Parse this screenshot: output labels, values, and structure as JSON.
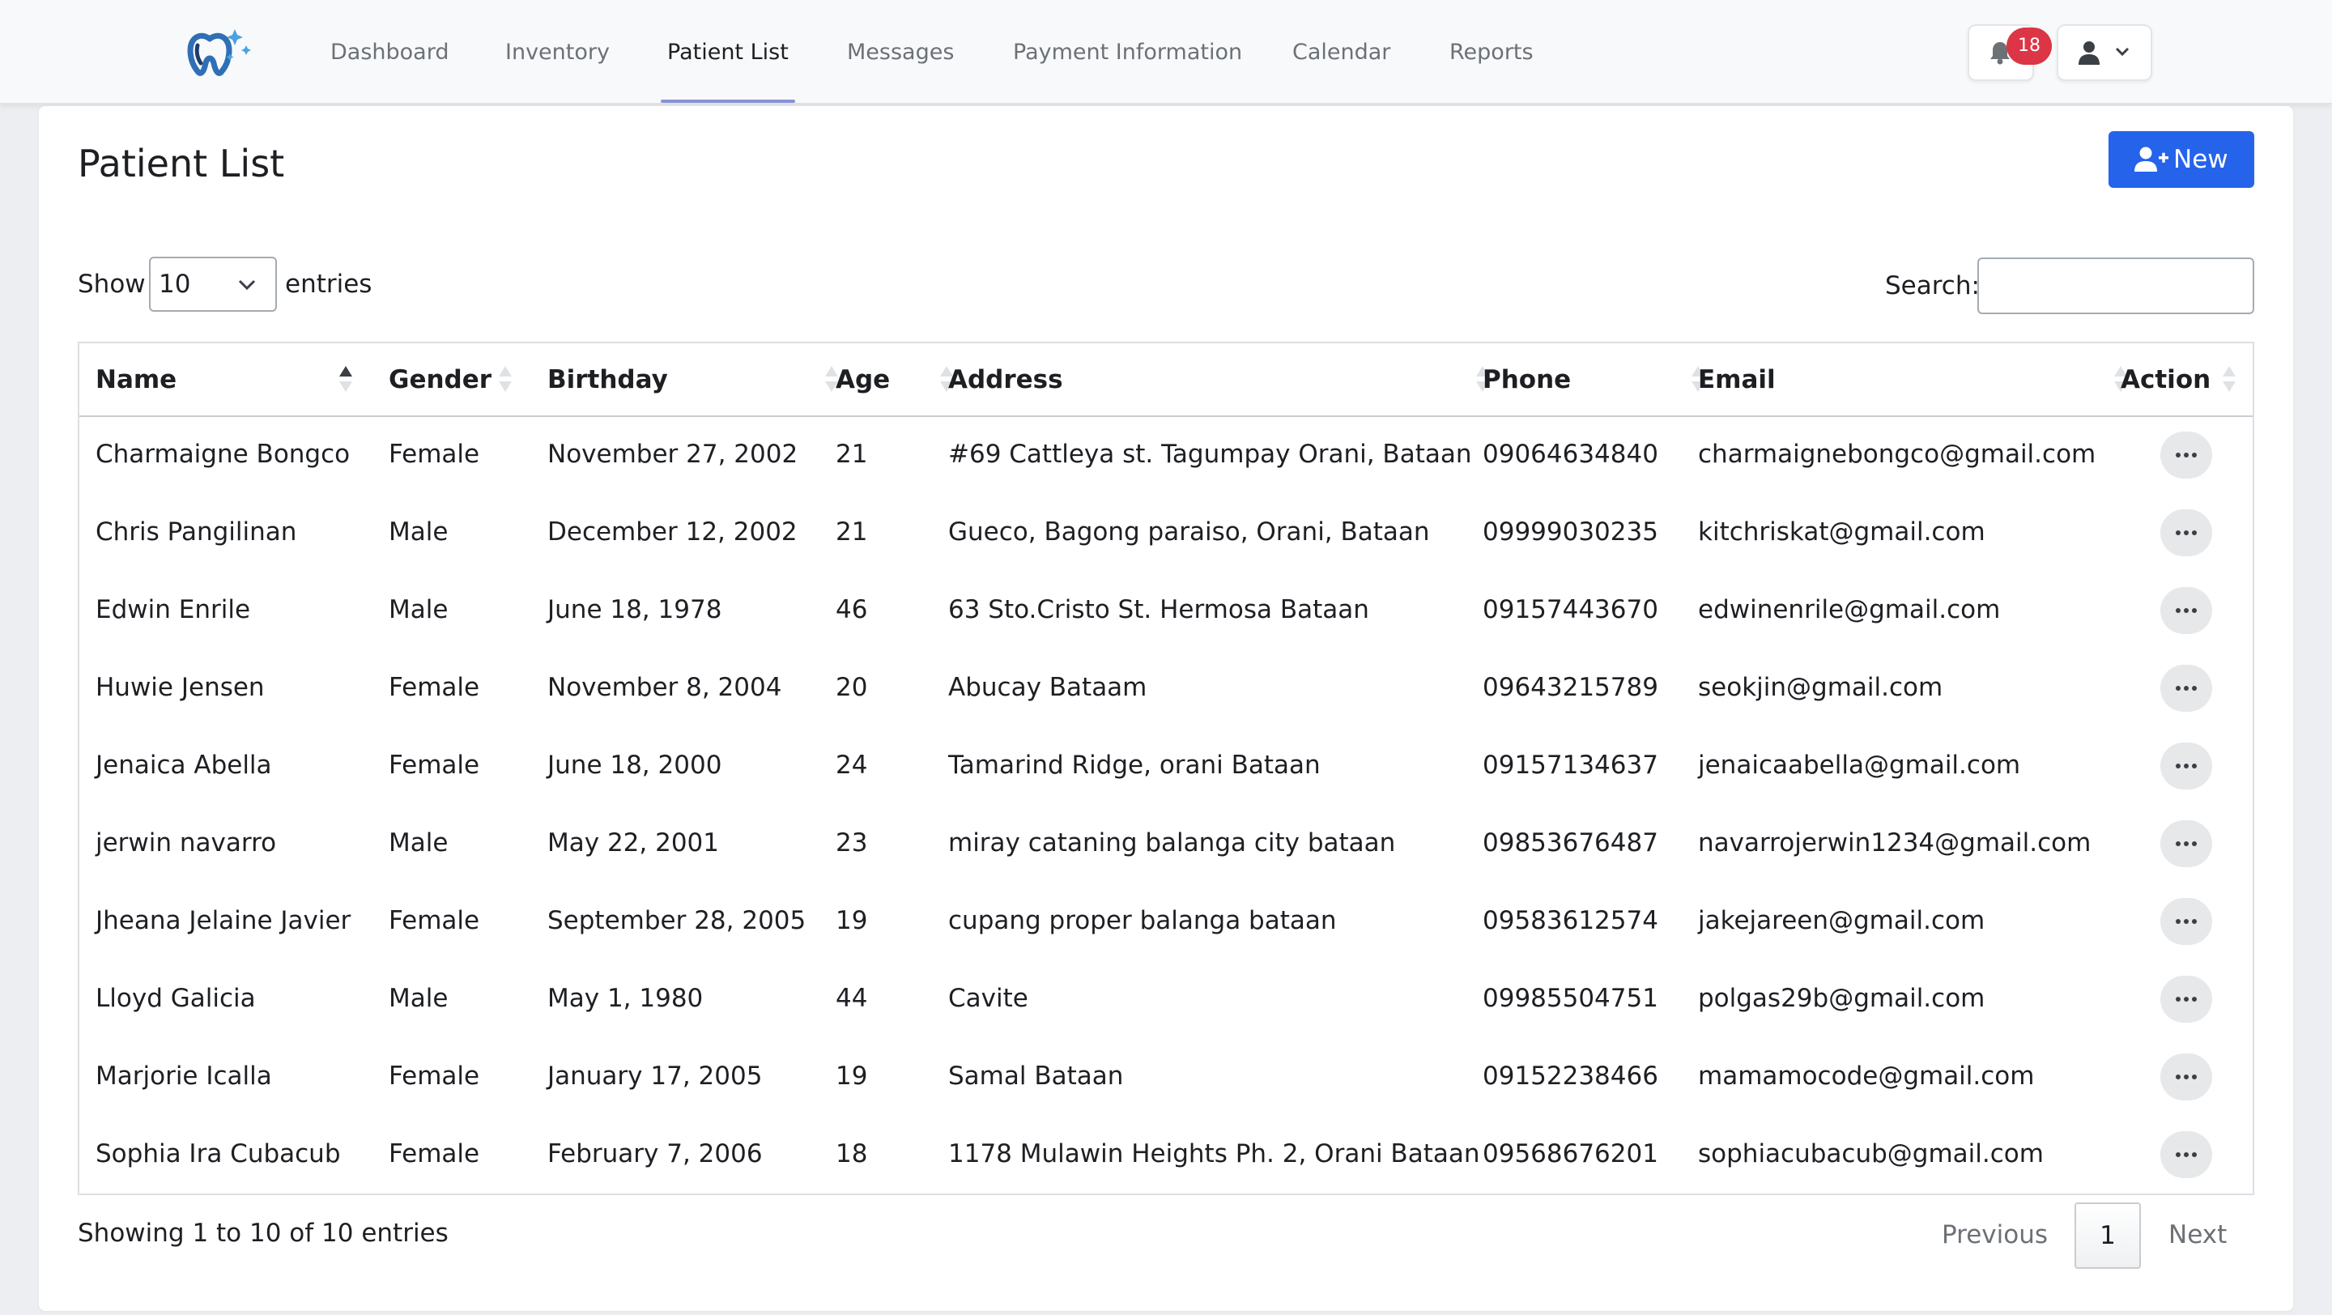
{
  "navbar": {
    "links": [
      {
        "label": "Dashboard"
      },
      {
        "label": "Inventory"
      },
      {
        "label": "Patient List"
      },
      {
        "label": "Messages"
      },
      {
        "label": "Payment Information"
      },
      {
        "label": "Calendar"
      },
      {
        "label": "Reports"
      }
    ],
    "active_link": "Patient List",
    "notification_count": "18",
    "accent_color": "#8a93d8"
  },
  "page": {
    "title": "Patient List",
    "new_button_label": "New",
    "new_button_color": "#2563eb"
  },
  "controls": {
    "show_label": "Show",
    "entries_value": "10",
    "entries_label": "entries",
    "search_label": "Search:",
    "search_value": ""
  },
  "table": {
    "columns": [
      "Name",
      "Gender",
      "Birthday",
      "Age",
      "Address",
      "Phone",
      "Email",
      "Action"
    ],
    "sorted_column": "Name",
    "sort_direction": "ascending",
    "rows": [
      {
        "name": "Charmaigne Bongco",
        "gender": "Female",
        "birthday": "November 27, 2002",
        "age": "21",
        "address": "#69 Cattleya st. Tagumpay Orani, Bataan",
        "phone": "09064634840",
        "email": "charmaignebongco@gmail.com"
      },
      {
        "name": "Chris Pangilinan",
        "gender": "Male",
        "birthday": "December 12, 2002",
        "age": "21",
        "address": "Gueco, Bagong paraiso, Orani, Bataan",
        "phone": "09999030235",
        "email": "kitchriskat@gmail.com"
      },
      {
        "name": "Edwin Enrile",
        "gender": "Male",
        "birthday": "June 18, 1978",
        "age": "46",
        "address": "63 Sto.Cristo St. Hermosa Bataan",
        "phone": "09157443670",
        "email": "edwinenrile@gmail.com"
      },
      {
        "name": "Huwie Jensen",
        "gender": "Female",
        "birthday": "November 8, 2004",
        "age": "20",
        "address": "Abucay Bataam",
        "phone": "09643215789",
        "email": "seokjin@gmail.com"
      },
      {
        "name": "Jenaica Abella",
        "gender": "Female",
        "birthday": "June 18, 2000",
        "age": "24",
        "address": "Tamarind Ridge, orani Bataan",
        "phone": "09157134637",
        "email": "jenaicaabella@gmail.com"
      },
      {
        "name": "jerwin navarro",
        "gender": "Male",
        "birthday": "May 22, 2001",
        "age": "23",
        "address": "miray cataning balanga city bataan",
        "phone": "09853676487",
        "email": "navarrojerwin1234@gmail.com"
      },
      {
        "name": "Jheana Jelaine Javier",
        "gender": "Female",
        "birthday": "September 28, 2005",
        "age": "19",
        "address": "cupang proper balanga bataan",
        "phone": "09583612574",
        "email": "jakejareen@gmail.com"
      },
      {
        "name": "Lloyd Galicia",
        "gender": "Male",
        "birthday": "May 1, 1980",
        "age": "44",
        "address": "Cavite",
        "phone": "09985504751",
        "email": "polgas29b@gmail.com"
      },
      {
        "name": "Marjorie Icalla",
        "gender": "Female",
        "birthday": "January 17, 2005",
        "age": "19",
        "address": "Samal Bataan",
        "phone": "09152238466",
        "email": "mamamocode@gmail.com"
      },
      {
        "name": "Sophia Ira Cubacub",
        "gender": "Female",
        "birthday": "February 7, 2006",
        "age": "18",
        "address": "1178 Mulawin Heights Ph. 2, Orani Bataan",
        "phone": "09568676201",
        "email": "sophiacubacub@gmail.com"
      }
    ]
  },
  "footer": {
    "info": "Showing 1 to 10 of 10 entries",
    "previous_label": "Previous",
    "current_page": "1",
    "next_label": "Next"
  }
}
